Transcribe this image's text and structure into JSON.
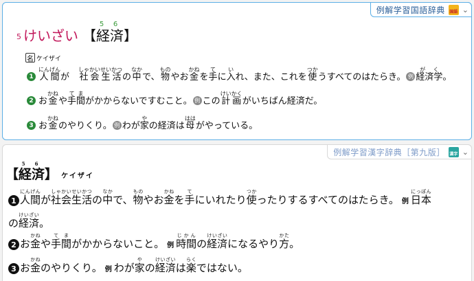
{
  "kokugo": {
    "dict_title": "例解学習国語辞典",
    "badge": "国語",
    "chevron": "⌄",
    "headword_number": "5",
    "headword_kana": "けいざい",
    "headword_kanji_open": "【",
    "headword_kanji_a": "経",
    "headword_kanji_a_grade": "5",
    "headword_kanji_b": "済",
    "headword_kanji_b_grade": "6",
    "headword_kanji_close": "】",
    "pos": "名",
    "pos_reading": "ケイザイ",
    "senses": {
      "s1": {
        "num": "1",
        "seg1": "人間",
        "seg1_rt": "にんげん",
        "seg2": "が　",
        "seg3": "社会生活",
        "seg3_rt": "しゃかいせいかつ",
        "seg4": "の",
        "seg5": "中",
        "seg5_rt": "なか",
        "seg6": "で、",
        "seg7": "物",
        "seg7_rt": "もの",
        "seg8": "やお",
        "seg9": "金",
        "seg9_rt": "かね",
        "seg10": "を",
        "seg11": "手",
        "seg11_rt": "て",
        "seg12": "に",
        "seg13": "入",
        "seg13_rt": "い",
        "seg14": "れ、また、これを",
        "seg15": "使",
        "seg15_rt": "つか",
        "seg16": "うすべてのはたらき。",
        "rei": "例",
        "seg17": "経済学",
        "seg17_rt": "がく",
        "seg18": "。"
      },
      "s2": {
        "num": "2",
        "seg1": "お",
        "seg2": "金",
        "seg2_rt": "かね",
        "seg3": "や",
        "seg4": "手間",
        "seg4_rt": "てま",
        "seg5": "がかからないですむこと。",
        "rei": "例",
        "seg6": "この ",
        "seg7": "計画",
        "seg7_rt": "けいかく",
        "seg8": " がいちばん経済だ。"
      },
      "s3": {
        "num": "3",
        "seg1": "お",
        "seg2": "金",
        "seg2_rt": "かね",
        "seg3": "のやりくり。",
        "rei": "例",
        "seg4": "わが",
        "seg5": "家",
        "seg5_rt": "や",
        "seg6": "の経済は",
        "seg7": "母",
        "seg7_rt": "はは",
        "seg8": "がやっている。"
      }
    }
  },
  "kanji": {
    "dict_title": "例解学習漢字辞典［第九版］",
    "badge": "漢字",
    "chevron": "⌄",
    "headword_open": "【",
    "headword_a": "経",
    "headword_a_grade": "5",
    "headword_b": "済",
    "headword_b_grade": "6",
    "headword_close": "】",
    "headword_reading": "ケイザイ",
    "senses": {
      "s1": {
        "num": "1",
        "seg1": "人間",
        "seg1_rt": "にんげん",
        "seg2": "が",
        "seg3": "社会生活",
        "seg3_rt": "しゃかいせいかつ",
        "seg4": "の",
        "seg5": "中",
        "seg5_rt": "なか",
        "seg6": "で、",
        "seg7": "物",
        "seg7_rt": "もの",
        "seg8": "やお",
        "seg9": "金",
        "seg9_rt": "かね",
        "seg10": "を",
        "seg11": "手",
        "seg11_rt": "て",
        "seg12": "にいれたり",
        "seg13": "使",
        "seg13_rt": "つか",
        "seg14": "ったりするすべてのはたらき。",
        "rei": "例",
        "seg15": "日本",
        "seg15_rt": "にっぽん",
        "cont1": "の",
        "cont2": "経済",
        "cont2_rt": "けいざい",
        "cont3": "。"
      },
      "s2": {
        "num": "2",
        "seg1": "お",
        "seg2": "金",
        "seg2_rt": "かね",
        "seg3": "や",
        "seg4": "手間",
        "seg4_rt": "てま",
        "seg5": "がかからないこと。",
        "rei": "例",
        "seg6": "時間",
        "seg6_rt": "じかん",
        "seg7": "の",
        "seg8": "経済",
        "seg8_rt": "けいざい",
        "seg9": "になるやり",
        "seg10": "方",
        "seg10_rt": "かた",
        "seg11": "。"
      },
      "s3": {
        "num": "3",
        "seg1": "お",
        "seg2": "金",
        "seg2_rt": "かね",
        "seg3": "のやりくり。",
        "rei": "例",
        "seg4": "わが",
        "seg5": "家",
        "seg5_rt": "や",
        "seg6": "の",
        "seg7": "経済",
        "seg7_rt": "けいざい",
        "seg8": "は",
        "seg9": "楽",
        "seg9_rt": "らく",
        "seg10": "ではない。"
      }
    }
  },
  "colors": {
    "kokugo_border": "#5aaee6",
    "headword_kana": "#c2185b",
    "grade_number": "#3a9a3a",
    "sense_number_bg": "#2a8a3a",
    "kanji_title": "#7f9cc9"
  }
}
